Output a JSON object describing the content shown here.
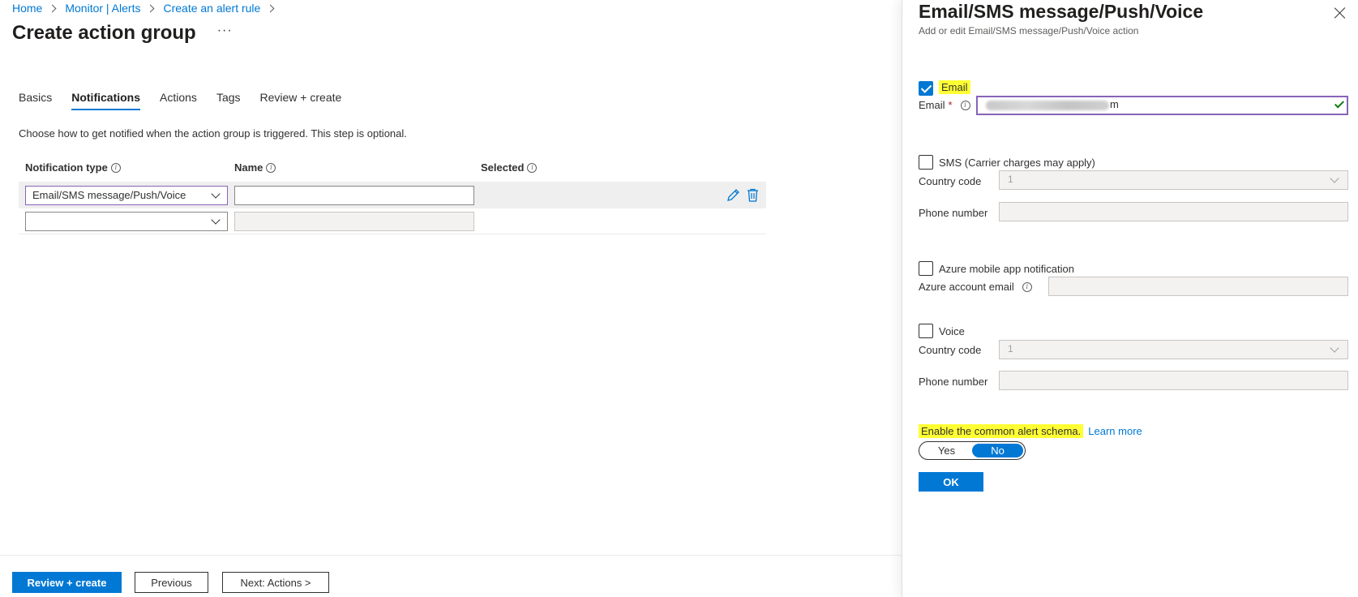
{
  "breadcrumb": [
    "Home",
    "Monitor | Alerts",
    "Create an alert rule"
  ],
  "page": {
    "title": "Create action group",
    "more_label": "···"
  },
  "tabs": [
    {
      "label": "Basics",
      "active": false
    },
    {
      "label": "Notifications",
      "active": true
    },
    {
      "label": "Actions",
      "active": false
    },
    {
      "label": "Tags",
      "active": false
    },
    {
      "label": "Review + create",
      "active": false
    }
  ],
  "notifications": {
    "description": "Choose how to get notified when the action group is triggered. This step is optional.",
    "columns": [
      "Notification type",
      "Name",
      "Selected"
    ],
    "rows": [
      {
        "type": "Email/SMS message/Push/Voice",
        "name": "",
        "selected": ""
      },
      {
        "type": "",
        "name": "",
        "selected": ""
      }
    ]
  },
  "footer": {
    "review_create": "Review + create",
    "previous": "Previous",
    "next": "Next: Actions >"
  },
  "blade": {
    "title": "Email/SMS message/Push/Voice",
    "subtitle": "Add or edit Email/SMS message/Push/Voice action",
    "email": {
      "checkbox_label": "Email",
      "checked": true,
      "field_label": "Email",
      "required_mark": "*",
      "value_tail": "m"
    },
    "sms": {
      "checkbox_label": "SMS (Carrier charges may apply)",
      "checked": false,
      "country_label": "Country code",
      "country_value": "1",
      "phone_label": "Phone number"
    },
    "push": {
      "checkbox_label": "Azure mobile app notification",
      "checked": false,
      "account_label": "Azure account email"
    },
    "voice": {
      "checkbox_label": "Voice",
      "checked": false,
      "country_label": "Country code",
      "country_value": "1",
      "phone_label": "Phone number"
    },
    "schema": {
      "label": "Enable the common alert schema.",
      "learn_more": "Learn more",
      "yes": "Yes",
      "no": "No",
      "selected": "No"
    },
    "ok": "OK"
  },
  "colors": {
    "accent": "#0078d4",
    "highlight": "#ffff33",
    "focus_border": "#8764b8",
    "valid_green": "#107c10"
  }
}
